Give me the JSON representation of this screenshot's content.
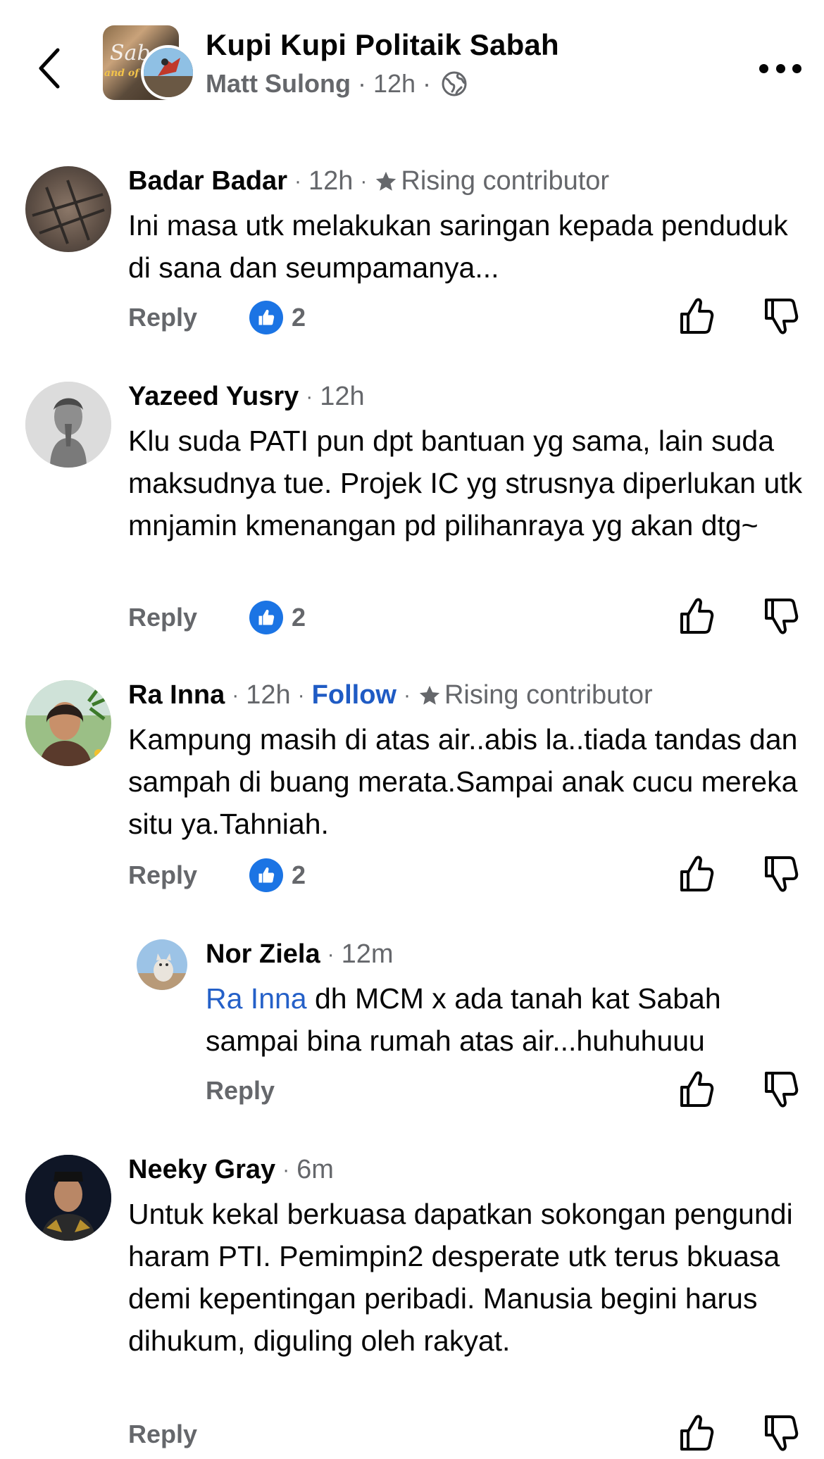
{
  "header": {
    "group_name": "Kupi Kupi Politaik Sabah",
    "poster": "Matt Sulong",
    "time": "12h",
    "avatar_text": "Sab",
    "avatar_subtext": "and of co"
  },
  "comments": [
    {
      "author": "Badar Badar",
      "time": "12h",
      "badge": "Rising contributor",
      "text": "Ini masa utk melakukan saringan kepada penduduk di sana dan seumpamanya...",
      "reply_label": "Reply",
      "reactions": "2"
    },
    {
      "author": "Yazeed Yusry",
      "time": "12h",
      "text": "Klu suda PATI pun dpt bantuan yg sama, lain suda maksudnya tue. Projek IC yg strusnya diperlukan utk mnjamin kmenangan pd pilihanraya yg akan dtg~",
      "reply_label": "Reply",
      "reactions": "2"
    },
    {
      "author": "Ra Inna",
      "time": "12h",
      "follow": "Follow",
      "badge": "Rising contributor",
      "text": "Kampung masih di atas air..abis la..tiada tandas dan sampah di buang merata.Sampai anak cucu mereka situ ya.Tahniah.",
      "reply_label": "Reply",
      "reactions": "2"
    },
    {
      "author": "Nor Ziela",
      "time": "12m",
      "mention": "Ra Inna",
      "text": " dh MCM x ada tanah kat Sabah sampai bina rumah atas air...huhuhuuu",
      "reply_label": "Reply"
    },
    {
      "author": "Neeky Gray",
      "time": "6m",
      "text": "Untuk kekal berkuasa dapatkan sokongan pengundi haram PTI. Pemimpin2 desperate utk terus bkuasa demi kepentingan peribadi. Manusia begini harus dihukum, diguling oleh rakyat.",
      "reply_label": "Reply"
    }
  ],
  "colors": {
    "secondary_text": "#65676b",
    "link": "#1f5bc4",
    "like_blue": "#1b74e4"
  }
}
